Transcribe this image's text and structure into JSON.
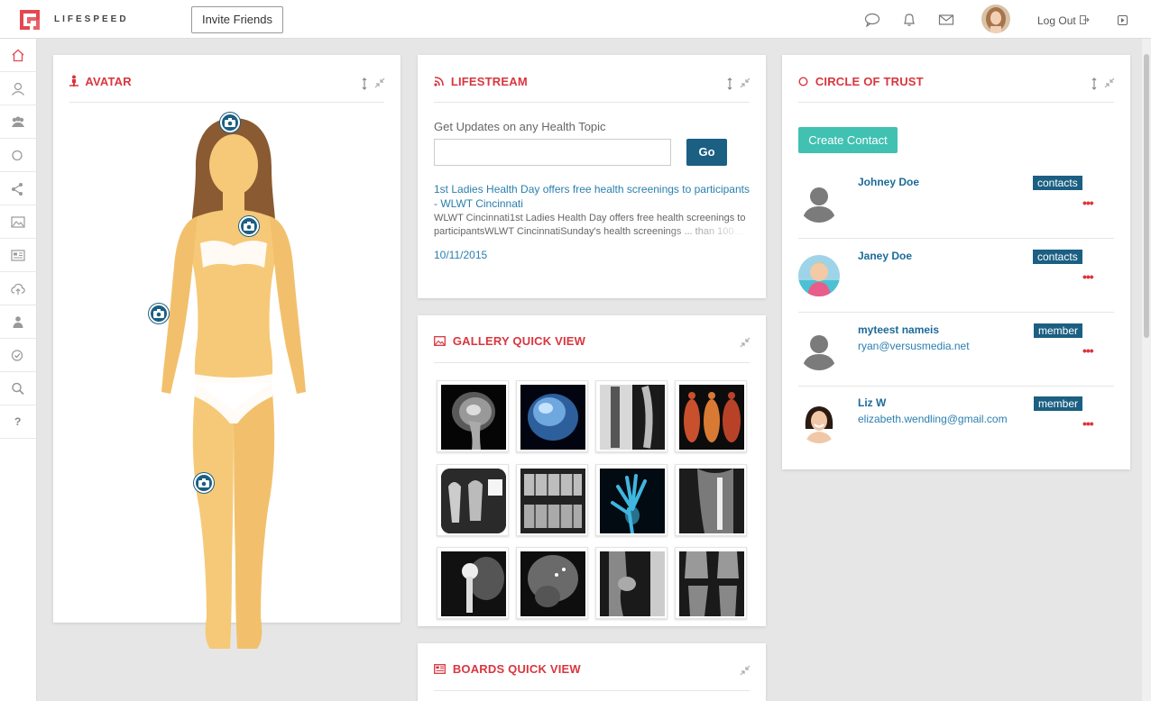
{
  "app": {
    "logo_text": "LIFESPEED"
  },
  "topbar": {
    "invite_label": "Invite Friends",
    "logout_label": "Log Out",
    "icons": [
      "chat-icon",
      "bell-icon",
      "mail-icon",
      "user-avatar",
      "logout-icon",
      "panel-toggle-icon"
    ]
  },
  "sidebar": {
    "items": [
      "home-icon",
      "user-icon",
      "group-icon",
      "circle-icon",
      "share-icon",
      "image-icon",
      "board-icon",
      "cloud-upload-icon",
      "person-icon",
      "check-circle-icon",
      "search-icon",
      "help-icon"
    ],
    "help_label": "?"
  },
  "avatar_panel": {
    "title": "AVATAR",
    "camera_pins": 4
  },
  "lifestream": {
    "title": "LIFESTREAM",
    "label": "Get Updates on any Health Topic",
    "input_value": "",
    "go_label": "Go",
    "article_title": "1st Ladies Health Day offers free health screenings to participants - WLWT Cincinnati",
    "article_desc": "WLWT Cincinnati1st Ladies Health Day offers free health screenings to participantsWLWT CincinnatiSunday's health screenings ... than 100 ...",
    "article_date": "10/11/2015"
  },
  "gallery": {
    "title": "GALLERY QUICK VIEW",
    "thumbnail_count": 12
  },
  "boards": {
    "title": "BOARDS QUICK VIEW"
  },
  "circle_of_trust": {
    "title": "CIRCLE OF TRUST",
    "create_label": "Create Contact",
    "contacts": [
      {
        "name": "Johney Doe",
        "email": "",
        "badge": "contacts"
      },
      {
        "name": "Janey Doe",
        "email": "",
        "badge": "contacts"
      },
      {
        "name": "myteest nameis",
        "email": "ryan@versusmedia.net",
        "badge": "member"
      },
      {
        "name": "Liz W",
        "email": "elizabeth.wendling@gmail.com",
        "badge": "member"
      }
    ],
    "more_label": "•••"
  },
  "colors": {
    "accent_red": "#d9363e",
    "button_blue": "#1b5f82",
    "teal": "#40c1b2",
    "link_blue": "#2a7fae",
    "skin": "#f6c978"
  }
}
